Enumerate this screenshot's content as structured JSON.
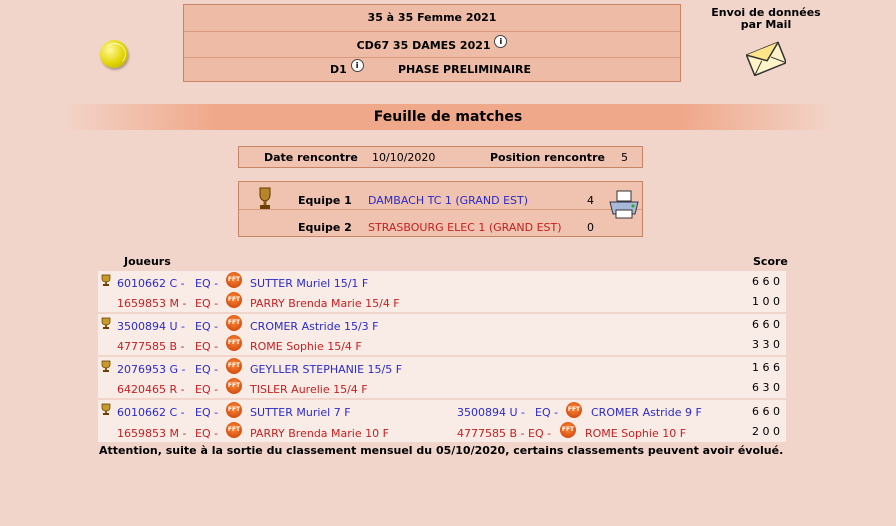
{
  "header": {
    "line1": "35  à 35  Femme  2021",
    "line2": "CD67 35 DAMES 2021",
    "line3_left": "D1",
    "line3_right": "PHASE PRELIMINAIRE",
    "info_glyph": "i"
  },
  "mail": {
    "line1": "Envoi de données",
    "line2": "par Mail"
  },
  "banner": {
    "title": "Feuille de matches"
  },
  "meeting": {
    "date_label": "Date rencontre",
    "date_value": "10/10/2020",
    "position_label": "Position rencontre",
    "position_value": "5"
  },
  "teams": {
    "team1_label": "Equipe 1",
    "team1_name": "DAMBACH TC 1 (GRAND EST)",
    "team1_score": "4",
    "team2_label": "Equipe 2",
    "team2_name": "STRASBOURG ELEC 1 (GRAND EST)",
    "team2_score": "0"
  },
  "table": {
    "col_players": "Joueurs",
    "col_score": "Score",
    "fft_logo": "FFT",
    "matches": [
      {
        "p1": {
          "id": "6010662 C -",
          "eq": "EQ -",
          "name": "SUTTER  Muriel  15/1 F"
        },
        "p2": {
          "id": "1659853 M -",
          "eq": "EQ -",
          "name": "PARRY  Brenda Marie 15/4 F"
        },
        "score1": "6 6 0",
        "score2": "1 0 0"
      },
      {
        "p1": {
          "id": "3500894 U -",
          "eq": "EQ -",
          "name": "CROMER  Astride  15/3 F"
        },
        "p2": {
          "id": "4777585 B -",
          "eq": "EQ -",
          "name": "ROME  Sophie 15/4 F"
        },
        "score1": "6 6 0",
        "score2": "3 3 0"
      },
      {
        "p1": {
          "id": "2076953 G -",
          "eq": "EQ -",
          "name": "GEYLLER  STEPHANIE  15/5 F"
        },
        "p2": {
          "id": "6420465 R -",
          "eq": "EQ -",
          "name": "TISLER  Aurelie 15/4 F"
        },
        "score1": "1 6 6",
        "score2": "6 3 0"
      }
    ],
    "double": {
      "p1a": {
        "id": "6010662 C -",
        "eq": "EQ -",
        "name": "SUTTER  Muriel  7 F"
      },
      "p1b": {
        "id": "3500894 U -",
        "eq": "EQ -",
        "name": "CROMER  Astride  9 F"
      },
      "p2a": {
        "id": "1659853 M -",
        "eq": "EQ -",
        "name": "PARRY  Brenda Marie 10 F"
      },
      "p2b": {
        "id": "4777585 B -",
        "eq": "EQ -",
        "name": "ROME  Sophie 10 F"
      },
      "score1": "6 6 0",
      "score2": "2 0 0"
    }
  },
  "footer": {
    "notice": "Attention, suite à la sortie du classement mensuel du 05/10/2020, certains classements peuvent avoir évolué."
  },
  "colors": {
    "page_bg": "#f2d5ca",
    "header_bg": "#eebba6",
    "home_player": "#2a2ac8",
    "away_player": "#c81e1e"
  }
}
